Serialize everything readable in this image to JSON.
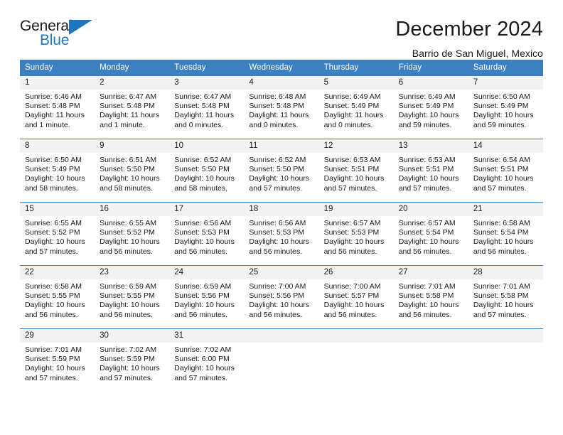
{
  "brand": {
    "name_part1": "General",
    "name_part2": "Blue"
  },
  "header": {
    "title": "December 2024",
    "subtitle": "Barrio de San Miguel, Mexico"
  },
  "colors": {
    "header_blue": "#3c80c0",
    "logo_blue": "#1f76bd",
    "daynum_band": "#f2f2f2",
    "text": "#1a1a1a"
  },
  "weekday_headers": [
    "Sunday",
    "Monday",
    "Tuesday",
    "Wednesday",
    "Thursday",
    "Friday",
    "Saturday"
  ],
  "weeks": [
    [
      {
        "day": "1",
        "sunrise": "Sunrise: 6:46 AM",
        "sunset": "Sunset: 5:48 PM",
        "daylight_line1": "Daylight: 11 hours",
        "daylight_line2": "and 1 minute."
      },
      {
        "day": "2",
        "sunrise": "Sunrise: 6:47 AM",
        "sunset": "Sunset: 5:48 PM",
        "daylight_line1": "Daylight: 11 hours",
        "daylight_line2": "and 1 minute."
      },
      {
        "day": "3",
        "sunrise": "Sunrise: 6:47 AM",
        "sunset": "Sunset: 5:48 PM",
        "daylight_line1": "Daylight: 11 hours",
        "daylight_line2": "and 0 minutes."
      },
      {
        "day": "4",
        "sunrise": "Sunrise: 6:48 AM",
        "sunset": "Sunset: 5:48 PM",
        "daylight_line1": "Daylight: 11 hours",
        "daylight_line2": "and 0 minutes."
      },
      {
        "day": "5",
        "sunrise": "Sunrise: 6:49 AM",
        "sunset": "Sunset: 5:49 PM",
        "daylight_line1": "Daylight: 11 hours",
        "daylight_line2": "and 0 minutes."
      },
      {
        "day": "6",
        "sunrise": "Sunrise: 6:49 AM",
        "sunset": "Sunset: 5:49 PM",
        "daylight_line1": "Daylight: 10 hours",
        "daylight_line2": "and 59 minutes."
      },
      {
        "day": "7",
        "sunrise": "Sunrise: 6:50 AM",
        "sunset": "Sunset: 5:49 PM",
        "daylight_line1": "Daylight: 10 hours",
        "daylight_line2": "and 59 minutes."
      }
    ],
    [
      {
        "day": "8",
        "sunrise": "Sunrise: 6:50 AM",
        "sunset": "Sunset: 5:49 PM",
        "daylight_line1": "Daylight: 10 hours",
        "daylight_line2": "and 58 minutes."
      },
      {
        "day": "9",
        "sunrise": "Sunrise: 6:51 AM",
        "sunset": "Sunset: 5:50 PM",
        "daylight_line1": "Daylight: 10 hours",
        "daylight_line2": "and 58 minutes."
      },
      {
        "day": "10",
        "sunrise": "Sunrise: 6:52 AM",
        "sunset": "Sunset: 5:50 PM",
        "daylight_line1": "Daylight: 10 hours",
        "daylight_line2": "and 58 minutes."
      },
      {
        "day": "11",
        "sunrise": "Sunrise: 6:52 AM",
        "sunset": "Sunset: 5:50 PM",
        "daylight_line1": "Daylight: 10 hours",
        "daylight_line2": "and 57 minutes."
      },
      {
        "day": "12",
        "sunrise": "Sunrise: 6:53 AM",
        "sunset": "Sunset: 5:51 PM",
        "daylight_line1": "Daylight: 10 hours",
        "daylight_line2": "and 57 minutes."
      },
      {
        "day": "13",
        "sunrise": "Sunrise: 6:53 AM",
        "sunset": "Sunset: 5:51 PM",
        "daylight_line1": "Daylight: 10 hours",
        "daylight_line2": "and 57 minutes."
      },
      {
        "day": "14",
        "sunrise": "Sunrise: 6:54 AM",
        "sunset": "Sunset: 5:51 PM",
        "daylight_line1": "Daylight: 10 hours",
        "daylight_line2": "and 57 minutes."
      }
    ],
    [
      {
        "day": "15",
        "sunrise": "Sunrise: 6:55 AM",
        "sunset": "Sunset: 5:52 PM",
        "daylight_line1": "Daylight: 10 hours",
        "daylight_line2": "and 57 minutes."
      },
      {
        "day": "16",
        "sunrise": "Sunrise: 6:55 AM",
        "sunset": "Sunset: 5:52 PM",
        "daylight_line1": "Daylight: 10 hours",
        "daylight_line2": "and 56 minutes."
      },
      {
        "day": "17",
        "sunrise": "Sunrise: 6:56 AM",
        "sunset": "Sunset: 5:53 PM",
        "daylight_line1": "Daylight: 10 hours",
        "daylight_line2": "and 56 minutes."
      },
      {
        "day": "18",
        "sunrise": "Sunrise: 6:56 AM",
        "sunset": "Sunset: 5:53 PM",
        "daylight_line1": "Daylight: 10 hours",
        "daylight_line2": "and 56 minutes."
      },
      {
        "day": "19",
        "sunrise": "Sunrise: 6:57 AM",
        "sunset": "Sunset: 5:53 PM",
        "daylight_line1": "Daylight: 10 hours",
        "daylight_line2": "and 56 minutes."
      },
      {
        "day": "20",
        "sunrise": "Sunrise: 6:57 AM",
        "sunset": "Sunset: 5:54 PM",
        "daylight_line1": "Daylight: 10 hours",
        "daylight_line2": "and 56 minutes."
      },
      {
        "day": "21",
        "sunrise": "Sunrise: 6:58 AM",
        "sunset": "Sunset: 5:54 PM",
        "daylight_line1": "Daylight: 10 hours",
        "daylight_line2": "and 56 minutes."
      }
    ],
    [
      {
        "day": "22",
        "sunrise": "Sunrise: 6:58 AM",
        "sunset": "Sunset: 5:55 PM",
        "daylight_line1": "Daylight: 10 hours",
        "daylight_line2": "and 56 minutes."
      },
      {
        "day": "23",
        "sunrise": "Sunrise: 6:59 AM",
        "sunset": "Sunset: 5:55 PM",
        "daylight_line1": "Daylight: 10 hours",
        "daylight_line2": "and 56 minutes."
      },
      {
        "day": "24",
        "sunrise": "Sunrise: 6:59 AM",
        "sunset": "Sunset: 5:56 PM",
        "daylight_line1": "Daylight: 10 hours",
        "daylight_line2": "and 56 minutes."
      },
      {
        "day": "25",
        "sunrise": "Sunrise: 7:00 AM",
        "sunset": "Sunset: 5:56 PM",
        "daylight_line1": "Daylight: 10 hours",
        "daylight_line2": "and 56 minutes."
      },
      {
        "day": "26",
        "sunrise": "Sunrise: 7:00 AM",
        "sunset": "Sunset: 5:57 PM",
        "daylight_line1": "Daylight: 10 hours",
        "daylight_line2": "and 56 minutes."
      },
      {
        "day": "27",
        "sunrise": "Sunrise: 7:01 AM",
        "sunset": "Sunset: 5:58 PM",
        "daylight_line1": "Daylight: 10 hours",
        "daylight_line2": "and 56 minutes."
      },
      {
        "day": "28",
        "sunrise": "Sunrise: 7:01 AM",
        "sunset": "Sunset: 5:58 PM",
        "daylight_line1": "Daylight: 10 hours",
        "daylight_line2": "and 57 minutes."
      }
    ],
    [
      {
        "day": "29",
        "sunrise": "Sunrise: 7:01 AM",
        "sunset": "Sunset: 5:59 PM",
        "daylight_line1": "Daylight: 10 hours",
        "daylight_line2": "and 57 minutes."
      },
      {
        "day": "30",
        "sunrise": "Sunrise: 7:02 AM",
        "sunset": "Sunset: 5:59 PM",
        "daylight_line1": "Daylight: 10 hours",
        "daylight_line2": "and 57 minutes."
      },
      {
        "day": "31",
        "sunrise": "Sunrise: 7:02 AM",
        "sunset": "Sunset: 6:00 PM",
        "daylight_line1": "Daylight: 10 hours",
        "daylight_line2": "and 57 minutes."
      },
      {
        "day": "",
        "sunrise": "",
        "sunset": "",
        "daylight_line1": "",
        "daylight_line2": ""
      },
      {
        "day": "",
        "sunrise": "",
        "sunset": "",
        "daylight_line1": "",
        "daylight_line2": ""
      },
      {
        "day": "",
        "sunrise": "",
        "sunset": "",
        "daylight_line1": "",
        "daylight_line2": ""
      },
      {
        "day": "",
        "sunrise": "",
        "sunset": "",
        "daylight_line1": "",
        "daylight_line2": ""
      }
    ]
  ]
}
